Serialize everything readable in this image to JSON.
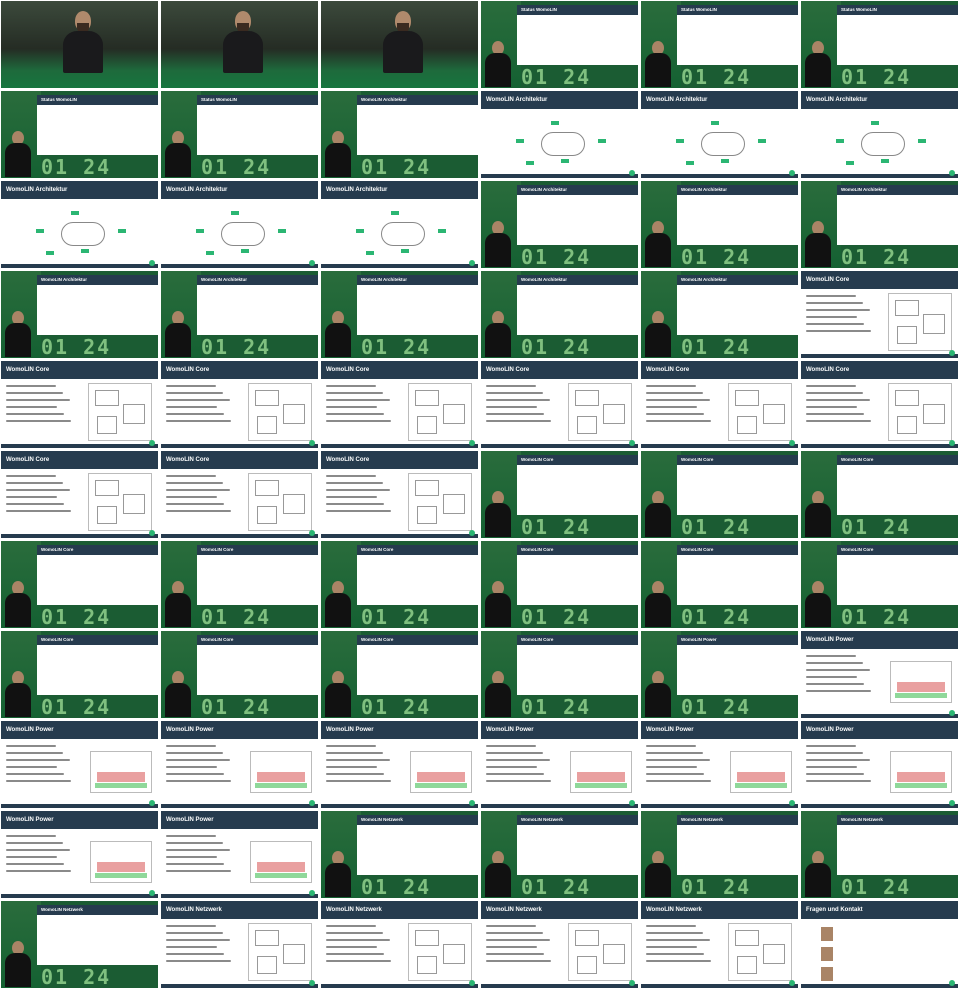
{
  "strip_numbers": "01 24",
  "slide_titles": {
    "status": "Status WomoLIN",
    "architektur": "WomoLIN Architektur",
    "core": "WomoLIN Core",
    "power": "WomoLIN Power",
    "netzwerk": "WomoLIN Netzwerk",
    "kontakt": "Fragen und Kontakt"
  },
  "tiles": [
    {
      "kind": "speaker",
      "title": ""
    },
    {
      "kind": "speaker",
      "title": ""
    },
    {
      "kind": "speaker",
      "title": ""
    },
    {
      "kind": "inset",
      "title": "status"
    },
    {
      "kind": "inset",
      "title": "status"
    },
    {
      "kind": "inset",
      "title": "status"
    },
    {
      "kind": "inset",
      "title": "status"
    },
    {
      "kind": "inset",
      "title": "status"
    },
    {
      "kind": "inset",
      "title": "architektur"
    },
    {
      "kind": "full",
      "title": "architektur"
    },
    {
      "kind": "full",
      "title": "architektur"
    },
    {
      "kind": "full",
      "title": "architektur"
    },
    {
      "kind": "full",
      "title": "architektur"
    },
    {
      "kind": "full",
      "title": "architektur"
    },
    {
      "kind": "full",
      "title": "architektur"
    },
    {
      "kind": "inset",
      "title": "architektur"
    },
    {
      "kind": "inset",
      "title": "architektur"
    },
    {
      "kind": "inset",
      "title": "architektur"
    },
    {
      "kind": "inset",
      "title": "architektur"
    },
    {
      "kind": "inset",
      "title": "architektur"
    },
    {
      "kind": "inset",
      "title": "architektur"
    },
    {
      "kind": "inset",
      "title": "architektur"
    },
    {
      "kind": "inset",
      "title": "architektur"
    },
    {
      "kind": "full",
      "title": "core"
    },
    {
      "kind": "full",
      "title": "core"
    },
    {
      "kind": "full",
      "title": "core"
    },
    {
      "kind": "full",
      "title": "core"
    },
    {
      "kind": "full",
      "title": "core"
    },
    {
      "kind": "full",
      "title": "core"
    },
    {
      "kind": "full",
      "title": "core"
    },
    {
      "kind": "full",
      "title": "core"
    },
    {
      "kind": "full",
      "title": "core"
    },
    {
      "kind": "full",
      "title": "core"
    },
    {
      "kind": "inset",
      "title": "core"
    },
    {
      "kind": "inset",
      "title": "core"
    },
    {
      "kind": "inset",
      "title": "core"
    },
    {
      "kind": "inset",
      "title": "core"
    },
    {
      "kind": "inset",
      "title": "core"
    },
    {
      "kind": "inset",
      "title": "core"
    },
    {
      "kind": "inset",
      "title": "core"
    },
    {
      "kind": "inset",
      "title": "core"
    },
    {
      "kind": "inset",
      "title": "core"
    },
    {
      "kind": "inset",
      "title": "core"
    },
    {
      "kind": "inset",
      "title": "core"
    },
    {
      "kind": "inset",
      "title": "core"
    },
    {
      "kind": "inset",
      "title": "core"
    },
    {
      "kind": "inset",
      "title": "power"
    },
    {
      "kind": "full",
      "title": "power"
    },
    {
      "kind": "full",
      "title": "power"
    },
    {
      "kind": "full",
      "title": "power"
    },
    {
      "kind": "full",
      "title": "power"
    },
    {
      "kind": "full",
      "title": "power"
    },
    {
      "kind": "full",
      "title": "power"
    },
    {
      "kind": "full",
      "title": "power"
    },
    {
      "kind": "full",
      "title": "power"
    },
    {
      "kind": "full",
      "title": "power"
    },
    {
      "kind": "inset",
      "title": "netzwerk"
    },
    {
      "kind": "inset",
      "title": "netzwerk"
    },
    {
      "kind": "inset",
      "title": "netzwerk"
    },
    {
      "kind": "inset",
      "title": "netzwerk"
    },
    {
      "kind": "inset",
      "title": "netzwerk"
    },
    {
      "kind": "full",
      "title": "netzwerk"
    },
    {
      "kind": "full",
      "title": "netzwerk"
    },
    {
      "kind": "full",
      "title": "netzwerk"
    },
    {
      "kind": "full",
      "title": "netzwerk"
    },
    {
      "kind": "full",
      "title": "kontakt"
    }
  ]
}
